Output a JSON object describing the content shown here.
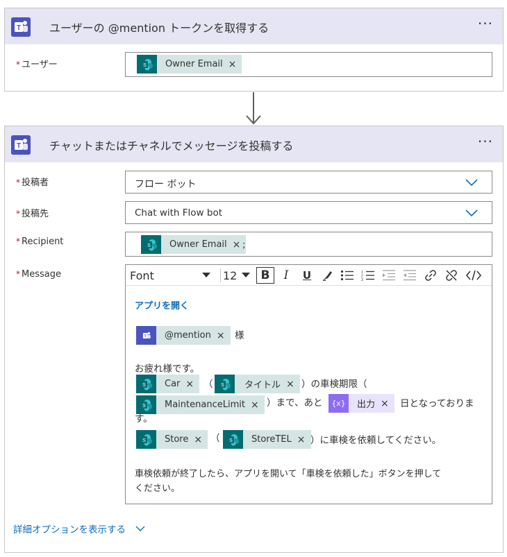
{
  "card1": {
    "title": "ユーザーの @mention トークンを取得する",
    "more": "···",
    "user_label": "ユーザー",
    "user_token": "Owner Email"
  },
  "card2": {
    "title": "チャットまたはチャネルでメッセージを投稿する",
    "more": "···",
    "poster_label": "投稿者",
    "poster_value": "フロー ボット",
    "postin_label": "投稿先",
    "postin_value": "Chat with Flow bot",
    "recipient_label": "Recipient",
    "recipient_token": "Owner Email",
    "recipient_sep": ";",
    "message_label": "Message",
    "toolbar": {
      "font": "Font",
      "size": "12",
      "bold": "B",
      "italic": "I",
      "underline": "U"
    },
    "message": {
      "link_text": "アプリを開く",
      "mention_token": "@mention",
      "honorific": "様",
      "greeting": "お疲れ様です。",
      "car_token": "Car",
      "paren_open": "（",
      "title_token": "タイトル",
      "deadline_text": "）の車検期限（",
      "limit_token": "MaintenanceLimit",
      "until_text": "）まで、あと",
      "output_token": "出力",
      "days_text": "日となっておりま",
      "days_text_2": "す。",
      "store_token": "Store",
      "paren_open_2": "（",
      "storetel_token": "StoreTEL",
      "request_text": "）に車検を依頼してください。",
      "footer_line1": "車検依頼が終了したら、アプリを開いて「車検を依頼した」ボタンを押して",
      "footer_line2": "ください。"
    },
    "advanced": "詳細オプションを表示する"
  },
  "token_remove": "×",
  "colors": {
    "accent": "#0f6cbd",
    "teams": "#4b53bc",
    "sharepoint": "#036c70",
    "required": "#a4262c",
    "header_bg": "#e5e5f4"
  }
}
